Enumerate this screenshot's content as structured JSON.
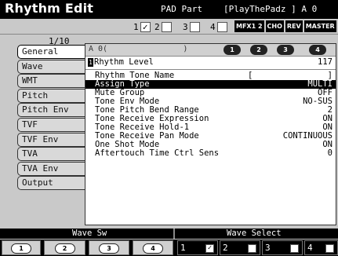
{
  "header": {
    "title": "Rhythm Edit",
    "part_label": "PAD Part",
    "part_name": "[PlayThePadz ] A 0"
  },
  "parts": [
    {
      "num": "1",
      "mark": "✓"
    },
    {
      "num": "2",
      "mark": ""
    },
    {
      "num": "3",
      "mark": ""
    },
    {
      "num": "4",
      "mark": ""
    }
  ],
  "fx_badges": [
    "MFX1 2",
    "CHO",
    "REV",
    "MASTER"
  ],
  "page_indicator": "1/10",
  "tabs": [
    "General",
    "Wave",
    "WMT",
    "Pitch",
    "Pitch Env",
    "TVF",
    "TVF Env",
    "TVA",
    "TVA Env",
    "Output"
  ],
  "active_tab": "General",
  "panel_head": {
    "wave_text": "A 0(                )",
    "knobs": [
      "1",
      "2",
      "3",
      "4"
    ]
  },
  "first_row": {
    "marker": "1",
    "label": "Rhythm Level",
    "value": "117"
  },
  "tone_name": {
    "label": "Rhythm Tone Name",
    "bracket_open": "[",
    "bracket_close": "]"
  },
  "params": [
    {
      "label": "Assign Type",
      "value": "MULTI",
      "selected": true
    },
    {
      "label": "Mute Group",
      "value": "OFF"
    },
    {
      "label": "Tone Env Mode",
      "value": "NO-SUS"
    },
    {
      "label": "Tone Pitch Bend Range",
      "value": "2"
    },
    {
      "label": "Tone Receive Expression",
      "value": "ON"
    },
    {
      "label": "Tone Receive Hold-1",
      "value": "ON"
    },
    {
      "label": "Tone Receive Pan Mode",
      "value": "CONTINUOUS"
    },
    {
      "label": "One Shot Mode",
      "value": "ON"
    },
    {
      "label": "Aftertouch Time Ctrl Sens",
      "value": "0"
    }
  ],
  "bottom": {
    "wave_sw_label": "Wave Sw",
    "wave_select_label": "Wave Select",
    "sw_knobs": [
      "1",
      "2",
      "3",
      "4"
    ],
    "wave_buttons": [
      {
        "num": "1",
        "mark": "✓"
      },
      {
        "num": "2",
        "mark": ""
      },
      {
        "num": "3",
        "mark": ""
      },
      {
        "num": "4",
        "mark": ""
      }
    ]
  }
}
